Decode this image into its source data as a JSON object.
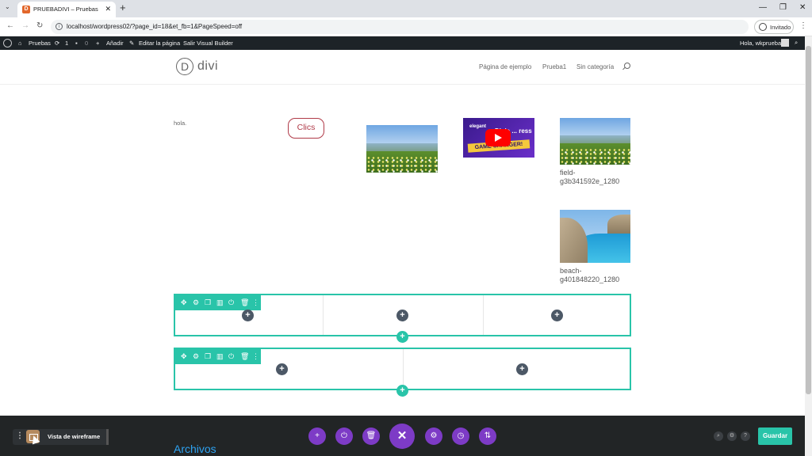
{
  "browser": {
    "tab_title": "PRUEBADIVI – Pruebas",
    "tab_favicon": "D",
    "tab_close": "✕",
    "new_tab": "+",
    "url": "localhost/wordpress02/?page_id=18&et_fb=1&PageSpeed=off",
    "profile_label": "Invitado",
    "win_min": "—",
    "win_max": "❐",
    "win_close": "✕"
  },
  "wp_admin": {
    "site_name": "Pruebas",
    "updates_count": "1",
    "comments_count": "0",
    "new_label": "Añadir",
    "edit_label": "Editar la página",
    "exit_vb_label": "Salir Visual Builder",
    "greeting": "Hola, wkprueba"
  },
  "site": {
    "logo_letter": "D",
    "logo_text": "divi",
    "menu": [
      "Página de ejemplo",
      "Prueba1",
      "Sin categoría"
    ]
  },
  "content": {
    "text_module": "hola.",
    "button_label": "Clics",
    "video_text_small": "elegant",
    "video_text_big": "Divie ... ress",
    "video_banner": "GAME CHANGER!",
    "gallery_captions": [
      "field-g3b341592e_1280",
      "beach-g401848220_1280"
    ],
    "archives_heading": "Archivos"
  },
  "rows": [
    {
      "columns": 3
    },
    {
      "columns": 2
    }
  ],
  "row_tool_icons": [
    "move-icon",
    "settings-icon",
    "duplicate-icon",
    "columns-icon",
    "power-icon",
    "trash-icon",
    "more-icon"
  ],
  "builder_bar": {
    "view_label": "Vista de wireframe",
    "save_label": "Guardar"
  },
  "colors": {
    "divi_teal": "#29c4a9",
    "divi_purple": "#7d3bc6",
    "button_red": "#b03a48",
    "archives_blue": "#2ea3f2"
  }
}
